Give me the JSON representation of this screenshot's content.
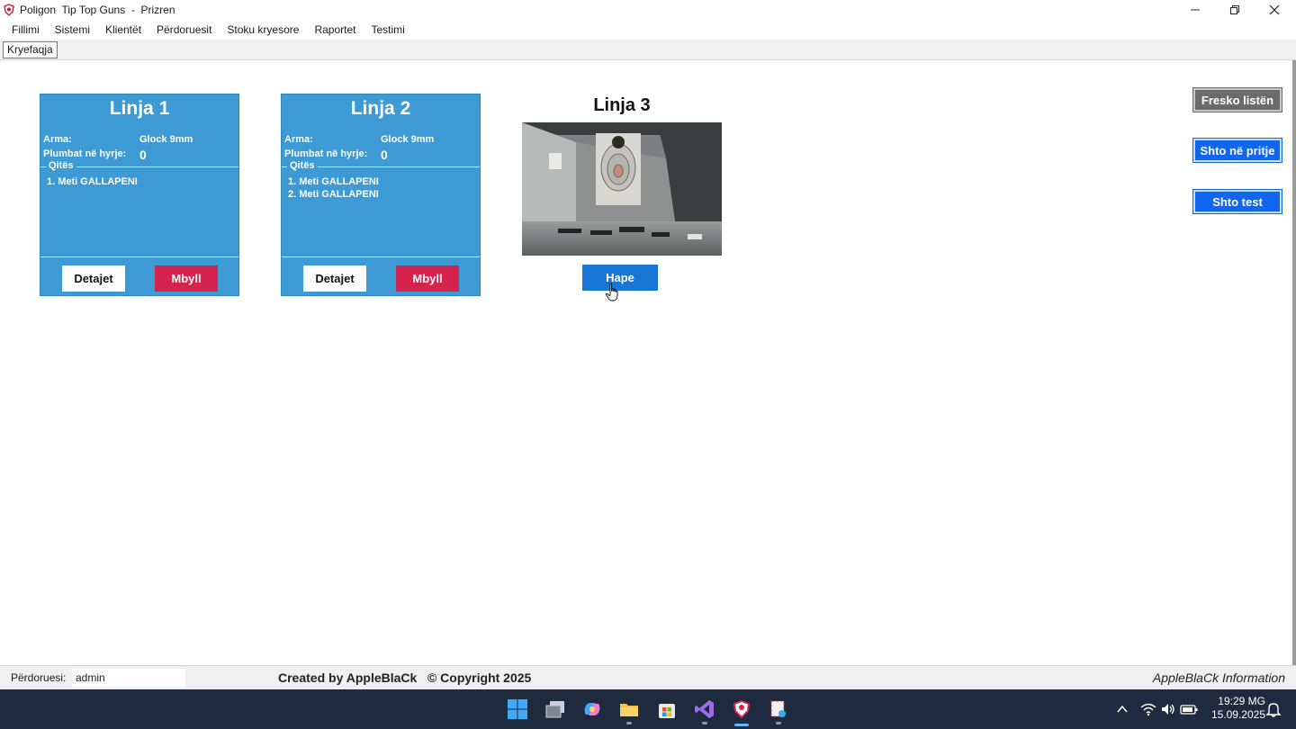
{
  "window": {
    "title": "Poligon  Tip Top Guns  -  Prizren"
  },
  "menu": [
    "Fillimi",
    "Sistemi",
    "Klientët",
    "Përdoruesit",
    "Stoku kryesore",
    "Raportet",
    "Testimi"
  ],
  "tab": "Kryefaqja",
  "lines": [
    {
      "title": "Linja 1",
      "weapon_label": "Arma:",
      "weapon": "Glock 9mm",
      "bullets_label": "Plumbat në hyrje:",
      "bullets": "0",
      "shooters_label": "Qitës",
      "shooters": [
        "1. Meti GALLAPENI"
      ],
      "details_btn": "Detajet",
      "close_btn": "Mbyll"
    },
    {
      "title": "Linja 2",
      "weapon_label": "Arma:",
      "weapon": "Glock 9mm",
      "bullets_label": "Plumbat në hyrje:",
      "bullets": "0",
      "shooters_label": "Qitës",
      "shooters": [
        "1. Meti GALLAPENI",
        "2. Meti GALLAPENI"
      ],
      "details_btn": "Detajet",
      "close_btn": "Mbyll"
    }
  ],
  "line3": {
    "title": "Linja 3",
    "open_btn": "Hape"
  },
  "side_buttons": {
    "refresh": "Fresko listën",
    "add_waiting": "Shto në pritje",
    "add_test": "Shto test"
  },
  "status": {
    "user_label": "Përdoruesi:",
    "user": "admin",
    "credit": "Created by AppleBlaCk   © Copyright 2025",
    "info": "AppleBlaCk Information"
  },
  "clock": {
    "time": "19:29 MG",
    "date": "15.09.2025"
  },
  "colors": {
    "card_bg": "#3d9ad4",
    "close_btn": "#d4244e",
    "primary_btn": "#1166f0",
    "refresh_btn": "#6b6b6b",
    "taskbar": "#1e2a3d"
  }
}
